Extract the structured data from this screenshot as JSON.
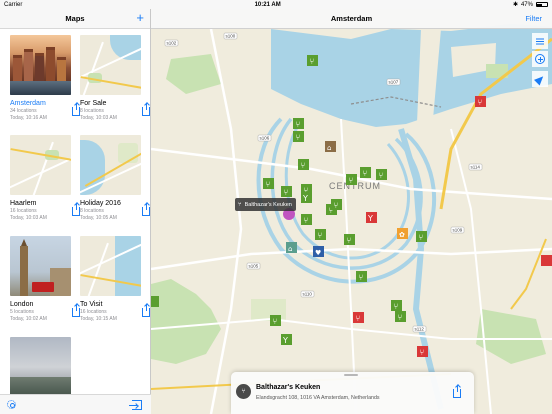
{
  "status_bar": {
    "carrier": "Carrier",
    "time": "10:21 AM",
    "battery": "47%",
    "wifi_icon": "wifi-icon",
    "battery_icon": "battery-icon"
  },
  "sidebar": {
    "title": "Maps",
    "add_icon": "plus-icon",
    "items": [
      {
        "name": "Amsterdam",
        "count": "34 locations",
        "updated": "Today, 10:16 AM",
        "active": true
      },
      {
        "name": "For Sale",
        "count": "8 locations",
        "updated": "Today, 10:03 AM"
      },
      {
        "name": "Haarlem",
        "count": "16 locations",
        "updated": "Today, 10:03 AM"
      },
      {
        "name": "Holiday 2016",
        "count": "8 locations",
        "updated": "Today, 10:05 AM"
      },
      {
        "name": "London",
        "count": "5 locations",
        "updated": "Today, 10:02 AM"
      },
      {
        "name": "To Visit",
        "count": "16 locations",
        "updated": "Today, 10:15 AM"
      }
    ],
    "footer": {
      "settings_icon": "gear-icon",
      "exit_icon": "exit-icon"
    }
  },
  "map": {
    "title": "Amsterdam",
    "filter_label": "Filter",
    "district_label": "CENTRUM",
    "road_labels": [
      "s102",
      "s100",
      "s105",
      "s106",
      "s107",
      "s112",
      "s109",
      "s110",
      "s114"
    ],
    "tooltip": "Balthazar's Keuken",
    "controls": [
      "list-icon",
      "zoom-in-icon",
      "location-arrow-icon"
    ],
    "legend_colors": {
      "restaurant_green": "#5a9e2f",
      "highlight_red": "#d93838",
      "selected_purple": "#c054c0",
      "museum_brown": "#8b6d46",
      "accent_blue": "#1a7cf5"
    }
  },
  "card": {
    "name": "Balthazar's Keuken",
    "address": "Elandsgracht 108, 1016 VA Amsterdam, Netherlands",
    "icon": "fork-knife-icon",
    "share_icon": "share-icon"
  }
}
